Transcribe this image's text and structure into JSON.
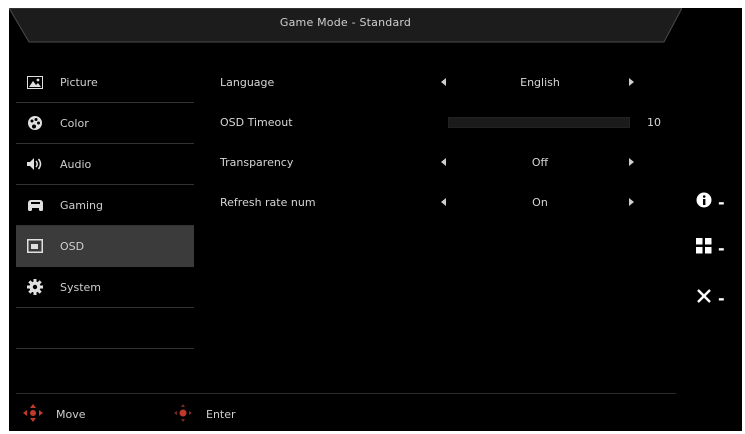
{
  "header": {
    "title": "Game Mode - Standard"
  },
  "sidebar": {
    "items": [
      {
        "label": "Picture",
        "icon": "picture-icon",
        "active": false
      },
      {
        "label": "Color",
        "icon": "palette-icon",
        "active": false
      },
      {
        "label": "Audio",
        "icon": "speaker-icon",
        "active": false
      },
      {
        "label": "Gaming",
        "icon": "gamepad-icon",
        "active": false
      },
      {
        "label": "OSD",
        "icon": "osd-icon",
        "active": true
      },
      {
        "label": "System",
        "icon": "gear-icon",
        "active": false
      }
    ]
  },
  "settings": {
    "language": {
      "label": "Language",
      "value": "English"
    },
    "osd_timeout": {
      "label": "OSD Timeout",
      "value": "10"
    },
    "transparency": {
      "label": "Transparency",
      "value": "Off"
    },
    "refresh_rate_num": {
      "label": "Refresh rate num",
      "value": "On"
    }
  },
  "footer": {
    "move_label": "Move",
    "enter_label": "Enter"
  },
  "side_keys": [
    {
      "icon": "info-icon",
      "label": "-"
    },
    {
      "icon": "menu-grid-icon",
      "label": "-"
    },
    {
      "icon": "close-icon",
      "label": "-"
    }
  ],
  "colors": {
    "background": "#000000",
    "active_item": "#3b3b3b",
    "accent_red": "#c0392b"
  }
}
